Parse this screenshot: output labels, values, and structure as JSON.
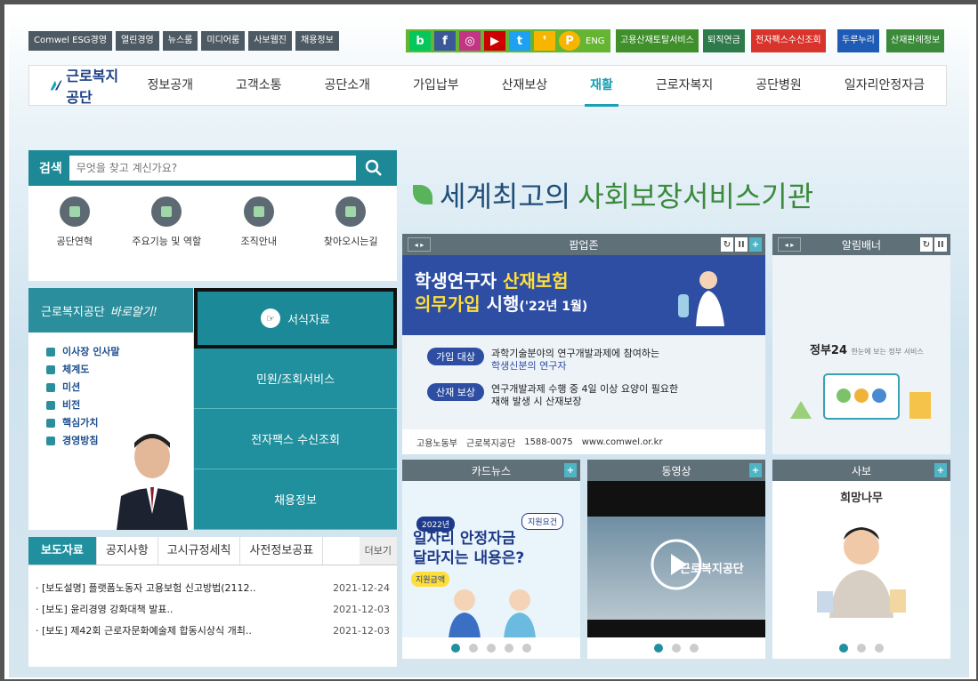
{
  "util_links": [
    "Comwel ESG경영",
    "열린경영",
    "뉴스룸",
    "미디어룸",
    "사보웹진",
    "채용정보"
  ],
  "sns": [
    {
      "icon": "blog-icon",
      "glyph": "b",
      "color": "#03c75a"
    },
    {
      "icon": "facebook-icon",
      "glyph": "f",
      "color": "#3b5998"
    },
    {
      "icon": "instagram-icon",
      "glyph": "◎",
      "color": "#c13584"
    },
    {
      "icon": "youtube-icon",
      "glyph": "▶",
      "color": "#cc0000"
    },
    {
      "icon": "twitter-icon",
      "glyph": "t",
      "color": "#1da1f2"
    },
    {
      "icon": "kakao-story-icon",
      "glyph": "❜",
      "color": "#f7b500"
    },
    {
      "icon": "kakao-plus-icon",
      "glyph": "P",
      "color": "#f7b500"
    }
  ],
  "eng_label": "ENG",
  "quick_links": [
    {
      "label": "고용산재토탈서비스",
      "color": "#3f8f2a"
    },
    {
      "label": "퇴직연금",
      "color": "#2e7a4a"
    },
    {
      "label": "전자팩스수신조회",
      "color": "#d9342b"
    },
    {
      "label": "두루누리",
      "color": "#1e5bb5"
    },
    {
      "label": "산재판례정보",
      "color": "#3a8a3a"
    }
  ],
  "brand": "근로복지공단",
  "menu": [
    "정보공개",
    "고객소통",
    "공단소개",
    "가입납부",
    "산재보상",
    "재활",
    "근로자복지",
    "공단병원",
    "일자리안정자금"
  ],
  "menu_active": "재활",
  "search": {
    "label": "검색",
    "placeholder": "무엇을 찾고 계신가요?"
  },
  "quick_icons": [
    {
      "label": "공단연혁",
      "icon": "hourglass-icon"
    },
    {
      "label": "주요기능 및 역할",
      "icon": "plant-icon"
    },
    {
      "label": "조직안내",
      "icon": "org-chart-icon"
    },
    {
      "label": "찾아오시는길",
      "icon": "location-pin-icon"
    }
  ],
  "know": {
    "title": "근로복지공단",
    "title_script": "바로알기!",
    "items": [
      "이사장 인사말",
      "체계도",
      "미션",
      "비전",
      "핵심가치",
      "경영방침"
    ]
  },
  "tiles": [
    "서식자료",
    "민원/조회서비스",
    "전자팩스 수신조회",
    "채용정보"
  ],
  "tile_hand": "☞",
  "news": {
    "tabs": [
      "보도자료",
      "공지사항",
      "고시규정세칙",
      "사전정보공표"
    ],
    "more": "더보기",
    "items": [
      {
        "title": "· [보도설명] 플랫폼노동자 고용보험 신고방법(2112..",
        "date": "2021-12-24"
      },
      {
        "title": "· [보도] 윤리경영 강화대책 발표..",
        "date": "2021-12-03"
      },
      {
        "title": "· [보도] 제42회 근로자문화예술제 합동시상식 개최..",
        "date": "2021-12-03"
      }
    ]
  },
  "slogan": {
    "part1": "세계최고의 ",
    "part2": "사회보장서비스기관"
  },
  "popup": {
    "title": "팝업존",
    "headline1a": "학생연구자 ",
    "headline1b": "산재보험",
    "headline2a": "의무가입",
    "headline2b": " 시행",
    "headline2c": "('22년 1월)",
    "row1_pill": "가입 대상",
    "row1_text": "과학기술분야의 연구개발과제에 참여하는",
    "row1_text2": "학생신분의 연구자",
    "row2_pill": "산재 보상",
    "row2_text": "연구개발과제 수행 중 4일 이상 요양이 필요한",
    "row2_text2": "재해 발생 시 산재보장",
    "foot_moel": "고용노동부",
    "foot_brand": "근로복지공단",
    "foot_phone": "1588-0075",
    "foot_url": "www.comwel.or.kr"
  },
  "notice": {
    "title": "알림배너",
    "gov": "정부24",
    "gov_sub": "한눈에 보는 정부 서비스"
  },
  "card_news": {
    "title": "카드뉴스",
    "year": "2022년",
    "badge": "지원요건",
    "line1": "일자리 안정자금",
    "line2": "달라지는 내용은?",
    "tag": "지원금액"
  },
  "video": {
    "title": "동영상",
    "caption": "근로복지공단"
  },
  "webzine": {
    "title": "사보",
    "mag": "희망나무"
  },
  "symbols": {
    "prev_next": "◂ ▸",
    "refresh": "↻",
    "pause": "II",
    "plus": "+"
  }
}
